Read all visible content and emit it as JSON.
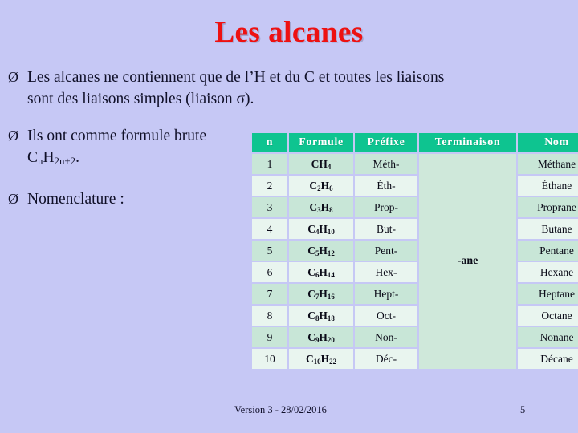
{
  "slide": {
    "title": "Les alcanes",
    "title_color": "#ee1111",
    "background_color": "#c6c8f5"
  },
  "bullets": [
    {
      "marker": "Ø",
      "marker_name": "arrow-bullet-icon",
      "line1": "Les alcanes ne contiennent que de l’H et du C et toutes les liaisons",
      "line2": "sont des liaisons simples (liaison σ)."
    },
    {
      "marker": "Ø",
      "marker_name": "arrow-bullet-icon",
      "line1": "Ils ont comme formule brute",
      "formula_prefix": "C",
      "formula_sub1": "n",
      "formula_mid": "H",
      "formula_sub2": "2n+2",
      "formula_suffix": "."
    },
    {
      "marker": "Ø",
      "marker_name": "arrow-bullet-icon",
      "line1": "Nomenclature :"
    }
  ],
  "table": {
    "header_bg": "#0ec490",
    "header_text_color": "#ffffff",
    "row_band_dark": "#c8e6d7",
    "row_band_light": "#e9f5ef",
    "merged_cell_bg": "#cfe8da",
    "headers": [
      "n",
      "Formule",
      "Préfixe",
      "Terminaison",
      "Nom"
    ],
    "termination_merged_value": "-ane",
    "rows": [
      {
        "n": "1",
        "formule_c": "C",
        "formule_c_sub": "",
        "formule_h": "H",
        "formule_h_sub": "4",
        "prefixe": "Méth-",
        "nom": "Méthane"
      },
      {
        "n": "2",
        "formule_c": "C",
        "formule_c_sub": "2",
        "formule_h": "H",
        "formule_h_sub": "6",
        "prefixe": "Éth-",
        "nom": "Éthane"
      },
      {
        "n": "3",
        "formule_c": "C",
        "formule_c_sub": "3",
        "formule_h": "H",
        "formule_h_sub": "8",
        "prefixe": "Prop-",
        "nom": "Proprane"
      },
      {
        "n": "4",
        "formule_c": "C",
        "formule_c_sub": "4",
        "formule_h": "H",
        "formule_h_sub": "10",
        "prefixe": "But-",
        "nom": "Butane"
      },
      {
        "n": "5",
        "formule_c": "C",
        "formule_c_sub": "5",
        "formule_h": "H",
        "formule_h_sub": "12",
        "prefixe": "Pent-",
        "nom": "Pentane"
      },
      {
        "n": "6",
        "formule_c": "C",
        "formule_c_sub": "6",
        "formule_h": "H",
        "formule_h_sub": "14",
        "prefixe": "Hex-",
        "nom": "Hexane"
      },
      {
        "n": "7",
        "formule_c": "C",
        "formule_c_sub": "7",
        "formule_h": "H",
        "formule_h_sub": "16",
        "prefixe": "Hept-",
        "nom": "Heptane"
      },
      {
        "n": "8",
        "formule_c": "C",
        "formule_c_sub": "8",
        "formule_h": "H",
        "formule_h_sub": "18",
        "prefixe": "Oct-",
        "nom": "Octane"
      },
      {
        "n": "9",
        "formule_c": "C",
        "formule_c_sub": "9",
        "formule_h": "H",
        "formule_h_sub": "20",
        "prefixe": "Non-",
        "nom": "Nonane"
      },
      {
        "n": "10",
        "formule_c": "C",
        "formule_c_sub": "10",
        "formule_h": "H",
        "formule_h_sub": "22",
        "prefixe": "Déc-",
        "nom": "Décane"
      }
    ]
  },
  "footer": {
    "version": "Version 3 - 28/02/2016",
    "page_number": "5"
  }
}
